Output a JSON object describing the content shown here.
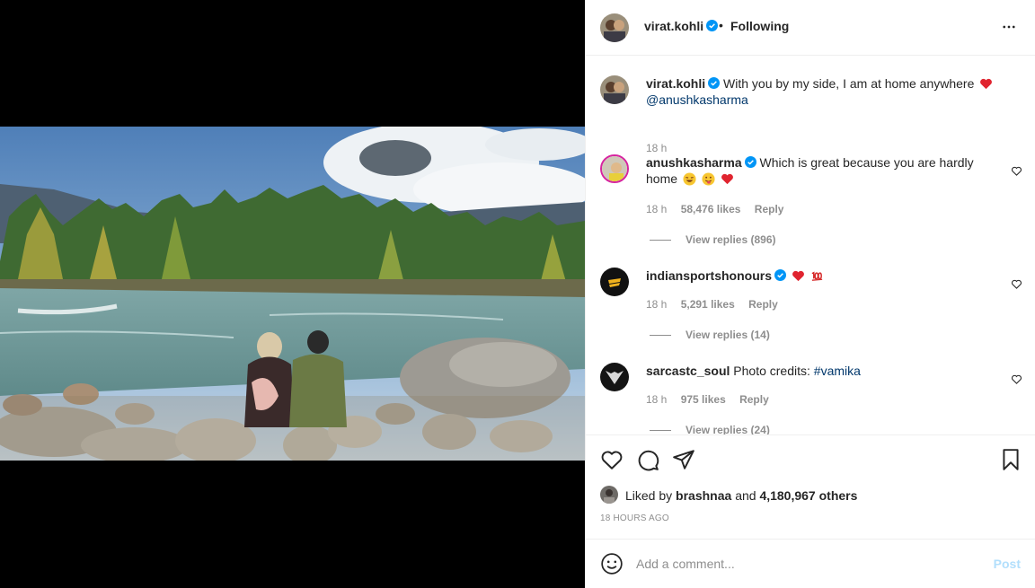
{
  "post": {
    "author": "virat.kohli",
    "follow_status": "Following",
    "separator": "•",
    "caption_text": "With you by my side, I am at home anywhere",
    "caption_mention": "@anushkasharma",
    "caption_time": "18 h"
  },
  "comments": [
    {
      "user": "anushkasharma",
      "text": "Which is great because you are hardly home",
      "time": "18 h",
      "likes": "58,476 likes",
      "reply": "Reply",
      "view_replies": "View replies (896)"
    },
    {
      "user": "indiansportshonours",
      "text": "",
      "time": "18 h",
      "likes": "5,291 likes",
      "reply": "Reply",
      "view_replies": "View replies (14)"
    },
    {
      "user": "sarcastc_soul",
      "text": "Photo credits:",
      "hashtag": "#vamika",
      "time": "18 h",
      "likes": "975 likes",
      "reply": "Reply",
      "view_replies": "View replies (24)"
    }
  ],
  "liked_by": {
    "prefix": "Liked by",
    "user": "brashnaa",
    "and": "and",
    "count": "4,180,967 others"
  },
  "timestamp": "18 HOURS AGO",
  "add_comment": {
    "placeholder": "Add a comment...",
    "post_label": "Post"
  },
  "colors": {
    "link": "#00376b",
    "muted": "#8e8e8e",
    "verified": "#0095f6",
    "heart": "#ed4956",
    "post_disabled": "#b2dffc"
  },
  "icons": [
    "more-icon",
    "verified-icon",
    "heart-icon",
    "comment-icon",
    "share-icon",
    "bookmark-icon",
    "smile-icon"
  ]
}
